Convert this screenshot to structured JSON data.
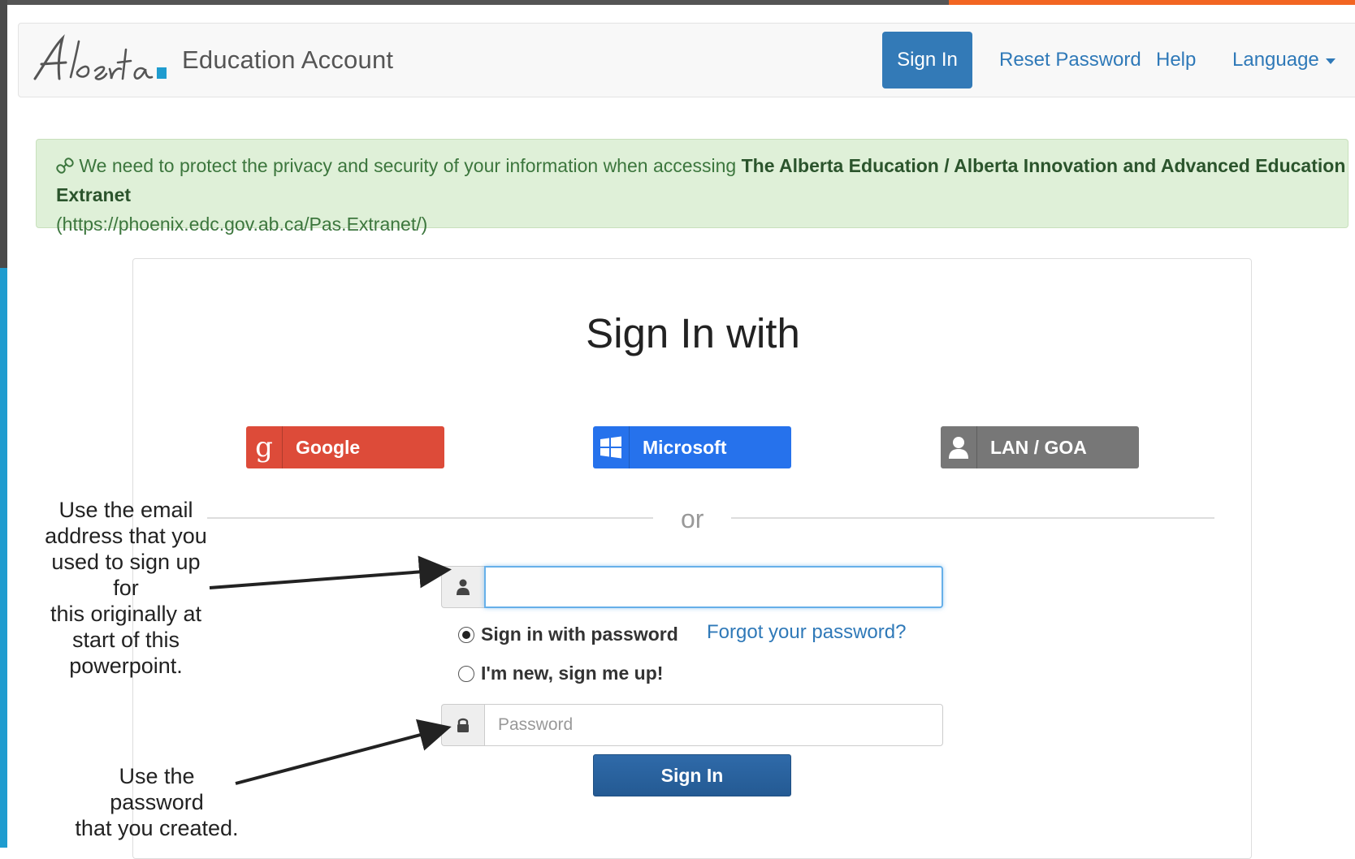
{
  "navbar": {
    "brand_text": "Education Account",
    "signin_label": "Sign In",
    "reset_label": "Reset Password",
    "help_label": "Help",
    "language_label": "Language"
  },
  "alert": {
    "icon": "link-icon",
    "text_before": "We need to protect the privacy and security of your information when accessing ",
    "app_name": "The Alberta Education / Alberta Innovation and Advanced Education Extranet",
    "url": "(https://phoenix.edc.gov.ab.ca/Pas.Extranet/)"
  },
  "signin": {
    "title": "Sign In with",
    "google_label": "Google",
    "microsoft_label": "Microsoft",
    "lan_label": "LAN / GOA",
    "or_text": "or",
    "email_value": "",
    "option_password": "Sign in with password",
    "option_new": "I'm new, sign me up!",
    "forgot_label": "Forgot your password?",
    "password_placeholder": "Password",
    "submit_label": "Sign In",
    "selected_option": "Sign in with password"
  },
  "annotations": {
    "email_note": [
      "Use the email",
      "address that you",
      "used to sign up for",
      "this originally at",
      "start of this",
      "powerpoint."
    ],
    "password_note": [
      "Use the password",
      "that you created."
    ]
  },
  "colors": {
    "primary": "#337ab7",
    "google": "#dd4b39",
    "microsoft": "#2672ec",
    "lan": "#777777",
    "alert_bg": "#dff0d8",
    "accent_orange": "#f26522",
    "accent_blue": "#1f9ccf"
  }
}
